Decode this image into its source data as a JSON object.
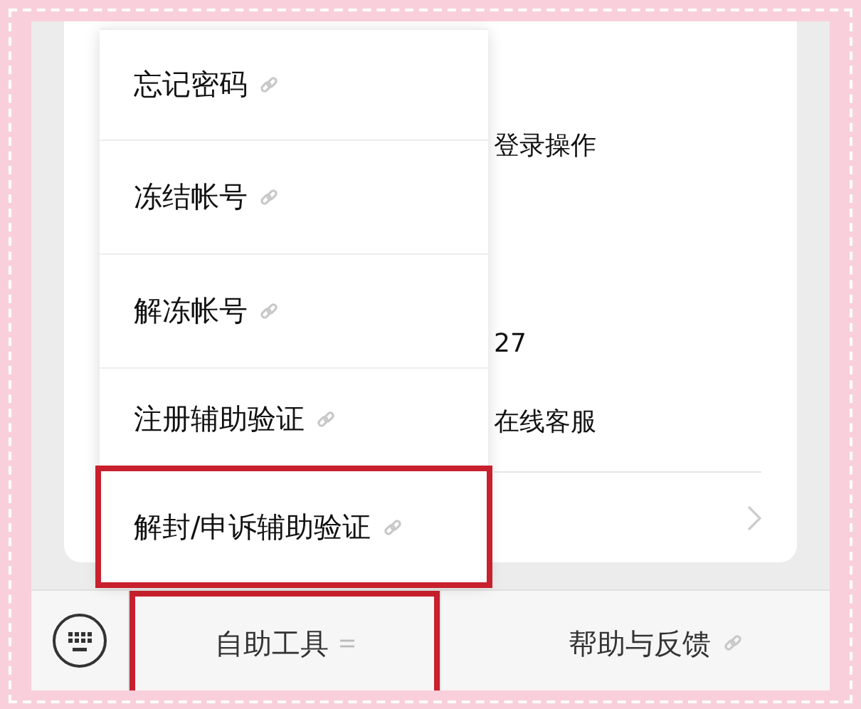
{
  "background_content": [
    {
      "text": "登录操作"
    },
    {
      "text": "27"
    },
    {
      "text": "在线客服"
    }
  ],
  "popup_menu": {
    "items": [
      {
        "label": "忘记密码",
        "highlighted": false
      },
      {
        "label": "冻结帐号",
        "highlighted": false
      },
      {
        "label": "解冻帐号",
        "highlighted": false
      },
      {
        "label": "注册辅助验证",
        "highlighted": false
      },
      {
        "label": "解封/申诉辅助验证",
        "highlighted": true
      }
    ]
  },
  "bottom_menu": {
    "tabs": [
      {
        "label": "自助工具",
        "highlighted": true
      },
      {
        "label": "帮助与反馈",
        "highlighted": false
      }
    ]
  }
}
